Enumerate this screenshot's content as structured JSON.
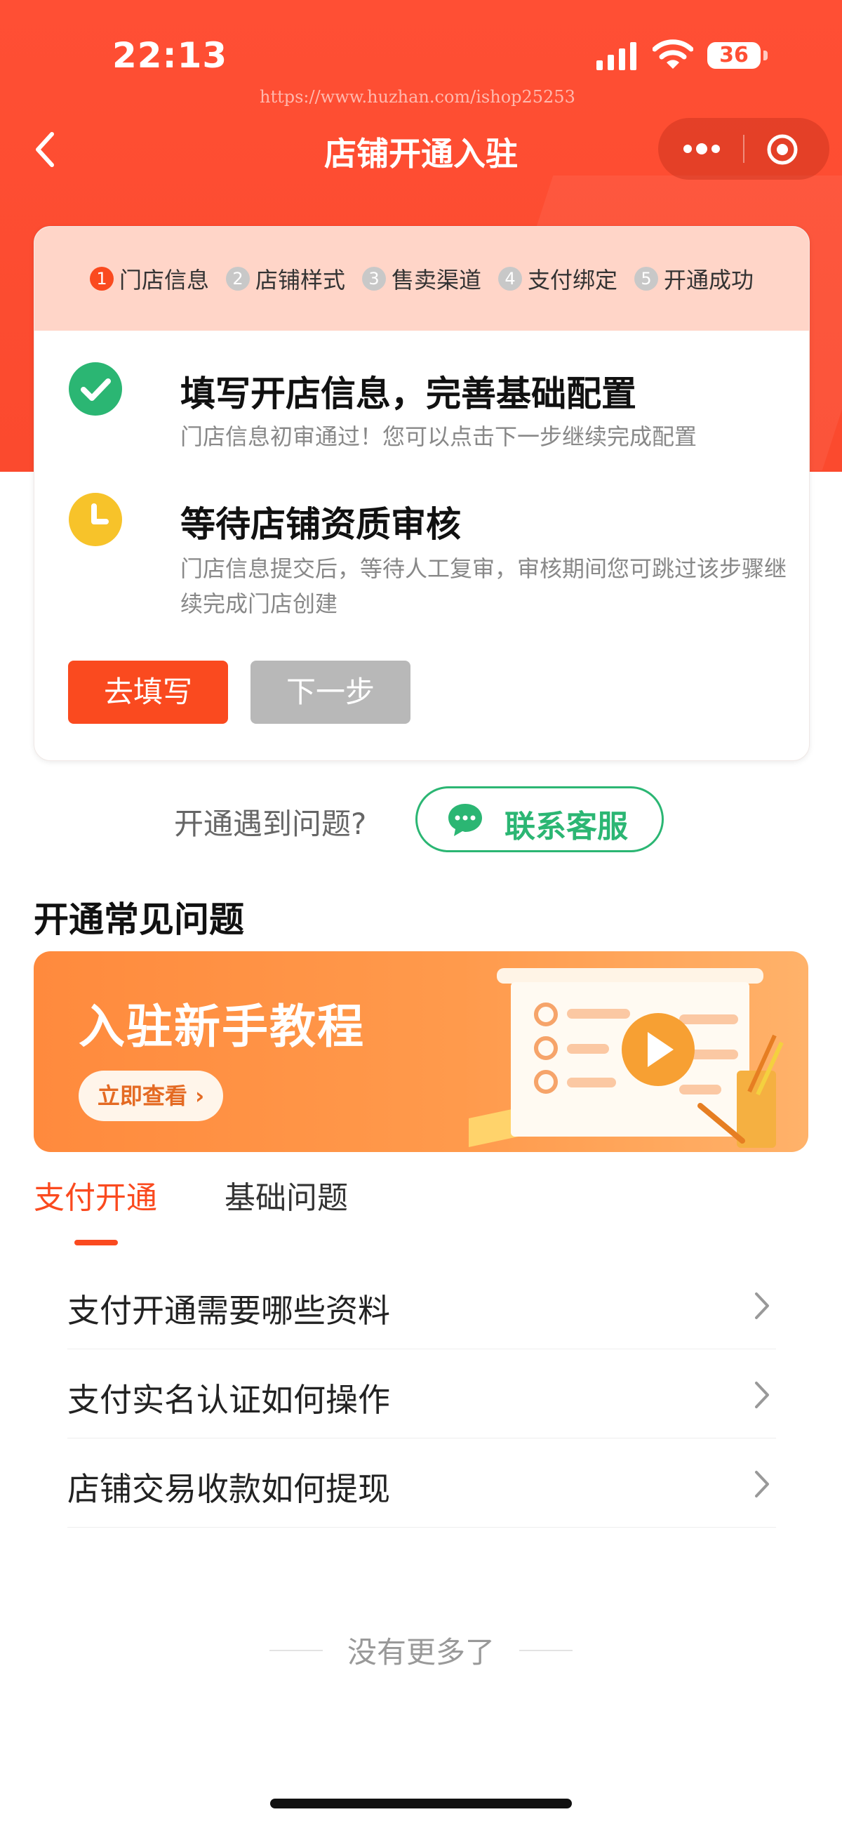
{
  "status_bar": {
    "time": "22:13",
    "battery": "36"
  },
  "watermark": "https://www.huzhan.com/ishop25253",
  "nav": {
    "title": "店铺开通入驻"
  },
  "steps": [
    {
      "num": "1",
      "label": "门店信息"
    },
    {
      "num": "2",
      "label": "店铺样式"
    },
    {
      "num": "3",
      "label": "售卖渠道"
    },
    {
      "num": "4",
      "label": "支付绑定"
    },
    {
      "num": "5",
      "label": "开通成功"
    }
  ],
  "tasks": [
    {
      "title": "填写开店信息，完善基础配置",
      "desc": "门店信息初审通过！您可以点击下一步继续完成配置"
    },
    {
      "title": "等待店铺资质审核",
      "desc": "门店信息提交后，等待人工复审，审核期间您可跳过该步骤继续完成门店创建"
    }
  ],
  "buttons": {
    "fill": "去填写",
    "next": "下一步"
  },
  "help": {
    "question": "开通遇到问题?",
    "contact": "联系客服"
  },
  "faq": {
    "title": "开通常见问题",
    "banner_title": "入驻新手教程",
    "banner_button": "立即查看 ›",
    "tabs": [
      "支付开通",
      "基础问题"
    ],
    "items": [
      "支付开通需要哪些资料",
      "支付实名认证如何操作",
      "店铺交易收款如何提现"
    ]
  },
  "footer": {
    "no_more": "没有更多了"
  },
  "colors": {
    "brand": "#fa4a1f",
    "success": "#2bb673",
    "pending": "#f7c32a"
  }
}
